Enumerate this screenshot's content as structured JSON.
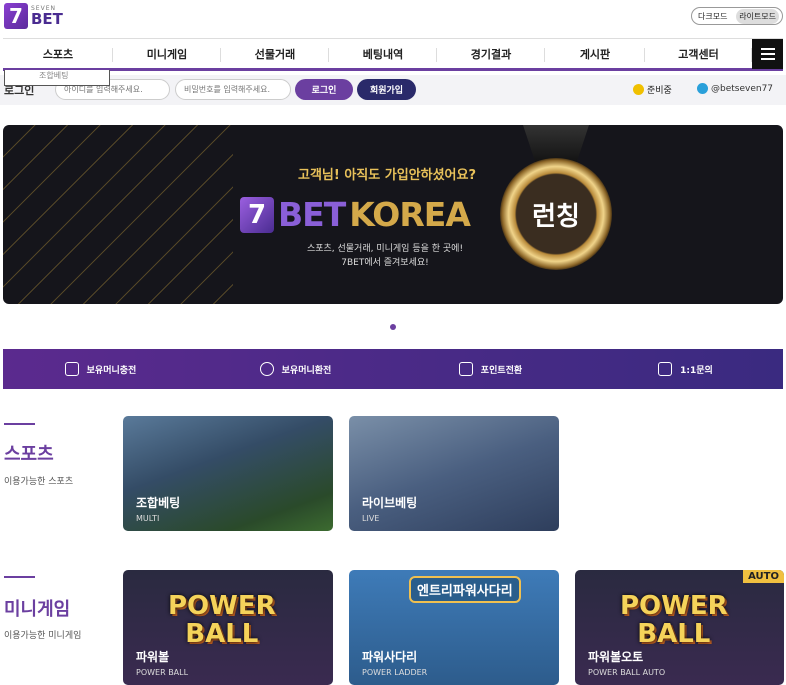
{
  "logo": {
    "mark": "7",
    "small": "SEVEN",
    "big": "BET"
  },
  "mode": {
    "dark": "다크모드",
    "light": "라이트모드"
  },
  "nav": {
    "items": [
      "스포츠",
      "미니게임",
      "선물거래",
      "베팅내역",
      "경기결과",
      "게시판",
      "고객센터"
    ],
    "dropdown": "조합베팅"
  },
  "login": {
    "label": "로그인",
    "id_placeholder": "아이디를 입력해주세요.",
    "pw_placeholder": "비밀번호를 입력해주세요.",
    "login_button": "로그인",
    "join_button": "회원가입",
    "status": "준비중",
    "telegram": "@betseven77"
  },
  "banner": {
    "question": "고객님! 아직도 가입안하셨어요?",
    "brand_mark": "7",
    "brand_bet": "BET",
    "brand_korea": "KOREA",
    "desc1": "스포츠, 선물거래, 미니게임 등을 한 곳에!",
    "desc2": "7BET에서 즐겨보세요!",
    "medal": "런칭"
  },
  "actions": [
    {
      "label": "보유머니충전"
    },
    {
      "label": "보유머니환전"
    },
    {
      "label": "포인트전환"
    },
    {
      "label": "1:1문의"
    }
  ],
  "sports": {
    "title": "스포츠",
    "subtitle": "이용가능한 스포츠",
    "cards": [
      {
        "name": "조합베팅",
        "en": "MULTI"
      },
      {
        "name": "라이브베팅",
        "en": "LIVE"
      }
    ]
  },
  "minigame": {
    "title": "미니게임",
    "subtitle": "이용가능한 미니게임",
    "cards": [
      {
        "name": "파워볼",
        "en": "POWER BALL",
        "logo1": "POWER",
        "logo2": "BALL"
      },
      {
        "name": "파워사다리",
        "en": "POWER LADDER",
        "logo": "엔트리파워사다리"
      },
      {
        "name": "파워볼오토",
        "en": "POWER BALL AUTO",
        "logo1": "POWER",
        "logo2": "BALL",
        "badge": "AUTO"
      }
    ]
  }
}
